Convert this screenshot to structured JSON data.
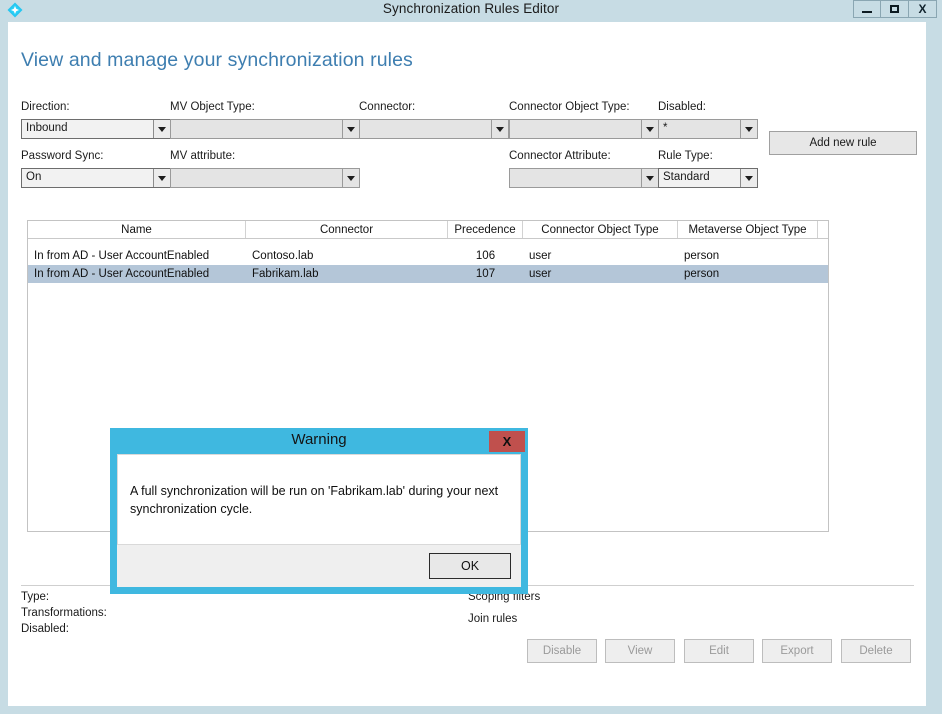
{
  "window": {
    "title": "Synchronization Rules Editor",
    "app_icon": "sync-diamond-icon",
    "minimize_label": "–",
    "maximize_label": "□",
    "close_label": "X"
  },
  "page": {
    "heading": "View and manage your synchronization rules"
  },
  "filters": {
    "direction": {
      "label": "Direction:",
      "value": "Inbound"
    },
    "mv_object_type": {
      "label": "MV Object Type:",
      "value": ""
    },
    "connector": {
      "label": "Connector:",
      "value": ""
    },
    "connector_object_type": {
      "label": "Connector Object Type:",
      "value": ""
    },
    "disabled": {
      "label": "Disabled:",
      "value": "*"
    },
    "password_sync": {
      "label": "Password Sync:",
      "value": "On"
    },
    "mv_attribute": {
      "label": "MV attribute:",
      "value": ""
    },
    "connector_attribute": {
      "label": "Connector Attribute:",
      "value": ""
    },
    "rule_type": {
      "label": "Rule Type:",
      "value": "Standard"
    }
  },
  "actions": {
    "add_new_rule": "Add new rule"
  },
  "grid": {
    "columns": [
      "Name",
      "Connector",
      "Precedence",
      "Connector Object Type",
      "Metaverse Object Type"
    ],
    "rows": [
      {
        "name": "In from AD - User AccountEnabled",
        "connector": "Contoso.lab",
        "precedence": "106",
        "connector_object_type": "user",
        "metaverse_object_type": "person",
        "selected": false
      },
      {
        "name": "In from AD - User AccountEnabled",
        "connector": "Fabrikam.lab",
        "precedence": "107",
        "connector_object_type": "user",
        "metaverse_object_type": "person",
        "selected": true
      }
    ]
  },
  "detail": {
    "type_label": "Type:",
    "transformations_label": "Transformations:",
    "disabled_label": "Disabled:",
    "scoping_filters_label": "Scoping filters",
    "join_rules_label": "Join rules"
  },
  "footer_buttons": {
    "disable": "Disable",
    "view": "View",
    "edit": "Edit",
    "export": "Export",
    "delete": "Delete"
  },
  "dialog": {
    "title": "Warning",
    "close_label": "X",
    "message": "A full synchronization will be run on 'Fabrikam.lab' during your next synchronization cycle.",
    "ok_label": "OK"
  },
  "colors": {
    "frame": "#c7dce4",
    "heading": "#3e7eb0",
    "dialog_accent": "#3fb8e0",
    "close_red": "#c0504d",
    "row_selected": "#b4c6d8"
  }
}
